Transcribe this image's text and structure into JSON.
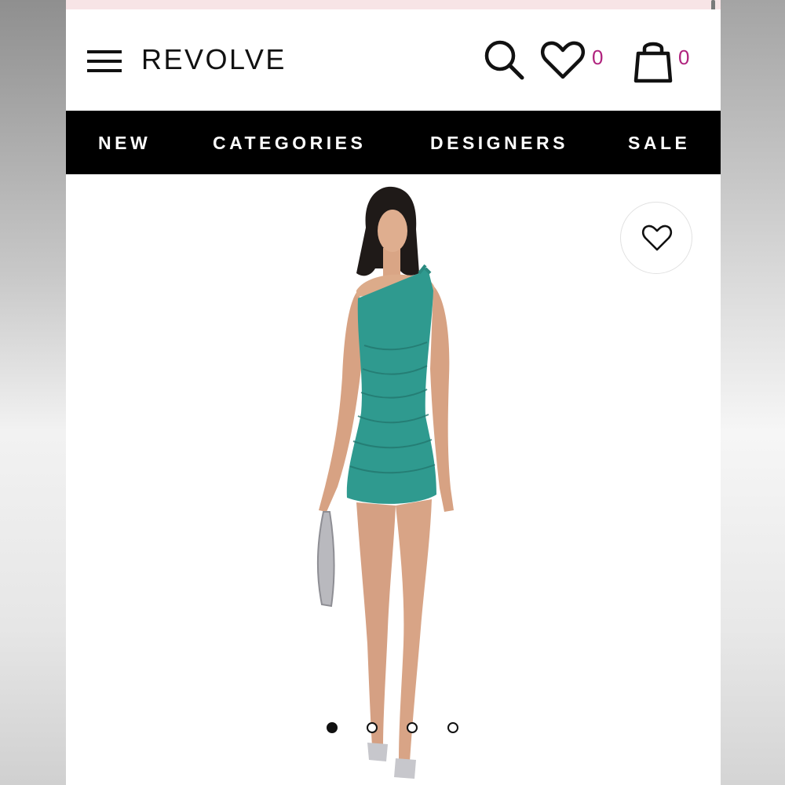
{
  "header": {
    "logo": "REVOLVE",
    "wishlist_count": "0",
    "bag_count": "0",
    "icons": {
      "menu": "hamburger-icon",
      "search": "search-icon",
      "wishlist": "heart-icon",
      "bag": "shopping-bag-icon"
    }
  },
  "nav": {
    "items": [
      {
        "label": "NEW"
      },
      {
        "label": "CATEGORIES"
      },
      {
        "label": "DESIGNERS"
      },
      {
        "label": "SALE"
      }
    ]
  },
  "product": {
    "favorite_icon": "heart-outline-icon",
    "carousel": {
      "total": 4,
      "active_index": 0
    },
    "dress_color": "#2f9a8f"
  },
  "colors": {
    "nav_background": "#000000",
    "nav_text": "#ffffff",
    "count_accent": "#b0237e",
    "promo_strip": "#f7e4e6"
  }
}
